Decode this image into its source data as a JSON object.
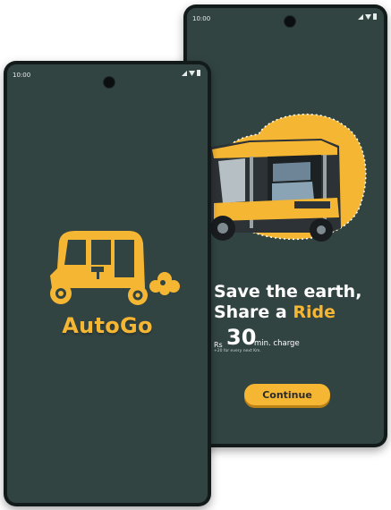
{
  "back_phone": {
    "status_time": "10:00",
    "headline_line1": "Save the earth,",
    "headline_line2_prefix": "Share a ",
    "headline_line2_accent": "Ride",
    "currency": "Rs",
    "price": "30",
    "price_unit": "min. charge",
    "price_note": "+20 for every next Km.",
    "continue_label": "Continue"
  },
  "front_phone": {
    "status_time": "10:00",
    "brand_name": "AutoGo"
  },
  "colors": {
    "screen_bg": "#324442",
    "accent": "#f5b733",
    "frame": "#121a1a"
  }
}
